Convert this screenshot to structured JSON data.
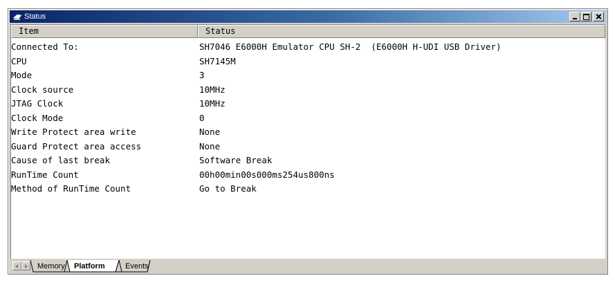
{
  "window": {
    "title": "Status"
  },
  "table": {
    "headers": {
      "item": "Item",
      "status": "Status"
    },
    "rows": [
      {
        "item": "Connected To:",
        "status": "SH7046 E6000H Emulator CPU SH-2  (E6000H H-UDI USB Driver)"
      },
      {
        "item": "CPU",
        "status": "SH7145M"
      },
      {
        "item": "Mode",
        "status": "3"
      },
      {
        "item": "Clock source",
        "status": "10MHz"
      },
      {
        "item": "JTAG Clock",
        "status": "10MHz"
      },
      {
        "item": "Clock Mode",
        "status": "0"
      },
      {
        "item": "Write Protect area write",
        "status": "None"
      },
      {
        "item": "Guard Protect area access",
        "status": "None"
      },
      {
        "item": "Cause of last break",
        "status": "Software Break"
      },
      {
        "item": "RunTime Count",
        "status": "00h00min00s000ms254us800ns"
      },
      {
        "item": "Method of RunTime Count",
        "status": "Go to Break"
      }
    ]
  },
  "tabs": [
    {
      "label": "Memory",
      "active": false
    },
    {
      "label": "Platform",
      "active": true
    },
    {
      "label": "Events",
      "active": false
    }
  ]
}
